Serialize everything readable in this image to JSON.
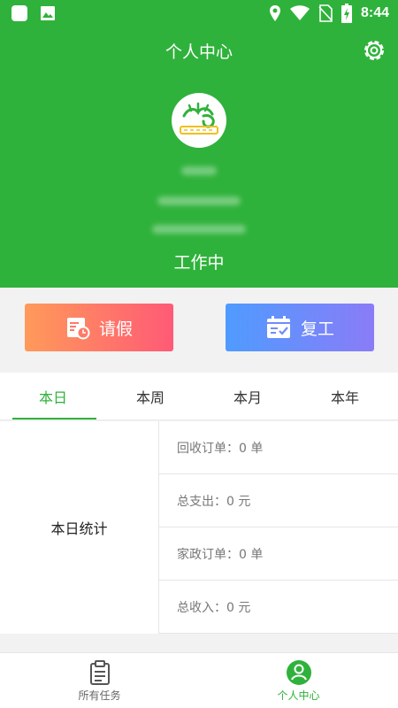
{
  "status_bar": {
    "time": "8:44",
    "icons": [
      "app-icon",
      "image-icon",
      "location-icon",
      "wifi-icon",
      "no-sim-icon",
      "battery-charging-icon"
    ]
  },
  "header": {
    "title": "个人中心",
    "work_status": "工作中"
  },
  "actions": {
    "leave_label": "请假",
    "resume_label": "复工"
  },
  "tabs": [
    {
      "label": "本日",
      "active": true
    },
    {
      "label": "本周",
      "active": false
    },
    {
      "label": "本月",
      "active": false
    },
    {
      "label": "本年",
      "active": false
    }
  ],
  "stats": {
    "period_label": "本日统计",
    "rows": [
      "回收订单：0 单",
      "总支出：0 元",
      "家政订单：0 单",
      "总收入：0 元"
    ]
  },
  "bottom_nav": [
    {
      "label": "所有任务",
      "active": false
    },
    {
      "label": "个人中心",
      "active": true
    }
  ],
  "colors": {
    "brand_green": "#2fb23b",
    "leave_gradient": [
      "#ff9a5a",
      "#ff5a76"
    ],
    "resume_gradient": [
      "#4f9bff",
      "#8a7cf7"
    ]
  }
}
